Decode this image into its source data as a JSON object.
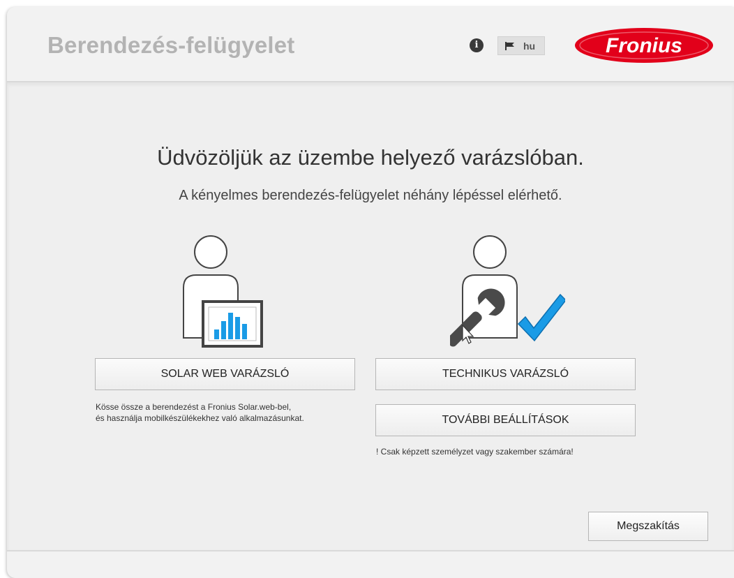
{
  "header": {
    "title": "Berendezés-felügyelet",
    "info_icon": "info-icon",
    "language": "hu",
    "flag_icon": "flag-icon",
    "logo_text": "Fronius",
    "logo_color": "#e2001a"
  },
  "welcome": {
    "title": "Üdvözöljük az üzembe helyező varázslóban.",
    "subtitle": "A kényelmes berendezés-felügyelet néhány lépéssel elérhető."
  },
  "solar_web": {
    "icon": "user-chart-icon",
    "button_label": "SOLAR WEB VARÁZSLÓ",
    "note_line1": "Kösse össze a berendezést a Fronius Solar.web-bel,",
    "note_line2": "és használja mobilkészülékekhez való alkalmazásunkat."
  },
  "technician": {
    "icon": "user-wrench-check-icon",
    "button_label": "TECHNIKUS VARÁZSLÓ",
    "more_settings_label": "TOVÁBBI BEÁLLÍTÁSOK",
    "note": "! Csak képzett személyzet vagy szakember számára!"
  },
  "footer": {
    "cancel_label": "Megszakítás"
  },
  "colors": {
    "accent_blue": "#1a9be6",
    "app_title_gray": "#b3b3b3"
  }
}
